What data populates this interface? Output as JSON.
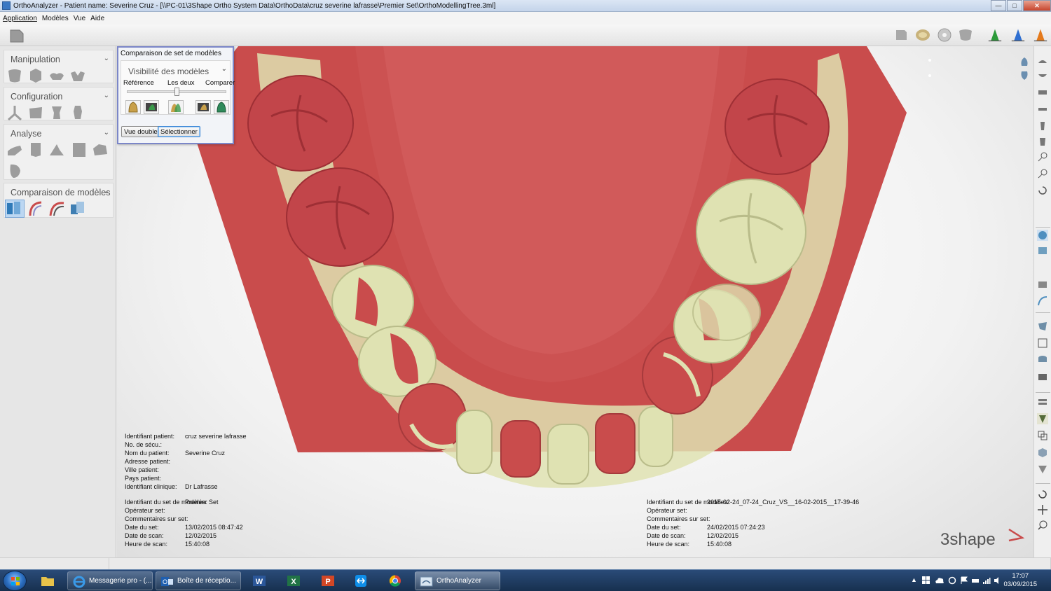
{
  "window": {
    "title": "OrthoAnalyzer - Patient name: Severine Cruz - [\\\\PC-01\\3Shape Ortho System Data\\OrthoData\\cruz severine lafrasse\\Premier Set\\OrthoModellingTree.3ml]",
    "controls": {
      "minimize": "—",
      "maximize": "□",
      "close": "✕"
    }
  },
  "menu": [
    "Application",
    "Modèles",
    "Vue",
    "Aide"
  ],
  "sidebar": {
    "panels": [
      {
        "title": "Manipulation",
        "chevron": "⌄"
      },
      {
        "title": "Configuration",
        "chevron": "⌄"
      },
      {
        "title": "Analyse",
        "chevron": "⌄"
      },
      {
        "title": "Comparaison de modèles",
        "chevron": "⌄"
      }
    ]
  },
  "comparison_dialog": {
    "title": "Comparaison de set de modèles",
    "visibility_title": "Visibilité des modèles",
    "labels": {
      "reference": "Référence",
      "both": "Les deux",
      "compare": "Comparer"
    },
    "slider_value": 0.5,
    "buttons": {
      "dual_view": "Vue double",
      "select": "Sélectionner"
    }
  },
  "patient_info": {
    "patient_id_label": "Identifiant patient:",
    "patient_id": "cruz severine lafrasse",
    "secu_label": "No. de sécu.:",
    "secu": "",
    "name_label": "Nom du patient:",
    "name": "Severine Cruz",
    "address_label": "Adresse patient:",
    "address": "",
    "city_label": "Ville patient:",
    "city": "",
    "country_label": "Pays patient:",
    "country": "",
    "clinic_label": "Identifiant clinique:",
    "clinic": "Dr Lafrasse"
  },
  "set_left": {
    "set_id_label": "Identifiant du set de modèles:",
    "set_id": "Premier Set",
    "operator_label": "Opérateur set:",
    "operator": "",
    "comments_label": "Commentaires sur set:",
    "comments": "",
    "date_label": "Date du set:",
    "date": "13/02/2015 08:47:42",
    "scan_date_label": "Date de scan:",
    "scan_date": "12/02/2015",
    "scan_time_label": "Heure de scan:",
    "scan_time": "15:40:08"
  },
  "set_right": {
    "set_id_label": "Identifiant du set de modèles:",
    "set_id": "2015-02-24_07-24_Cruz_VS__16-02-2015__17-39-46",
    "operator_label": "Opérateur set:",
    "operator": "",
    "comments_label": "Commentaires sur set:",
    "comments": "",
    "date_label": "Date du set:",
    "date": "24/02/2015 07:24:23",
    "scan_date_label": "Date de scan:",
    "scan_date": "12/02/2015",
    "scan_time_label": "Heure de scan:",
    "scan_time": "15:40:08"
  },
  "brand": "3shape",
  "colors": {
    "model_reference": "#c94c4c",
    "model_compare": "#dfe2b2",
    "accent": "#3a86d6"
  },
  "taskbar": {
    "apps": [
      {
        "label": "Messagerie pro - (...",
        "icon": "ie-icon"
      },
      {
        "label": "Boîte de réceptio...",
        "icon": "outlook-icon"
      },
      {
        "label": "OrthoAnalyzer",
        "icon": "orthoanalyzer-icon"
      }
    ],
    "time": "17:07",
    "date": "03/09/2015"
  }
}
